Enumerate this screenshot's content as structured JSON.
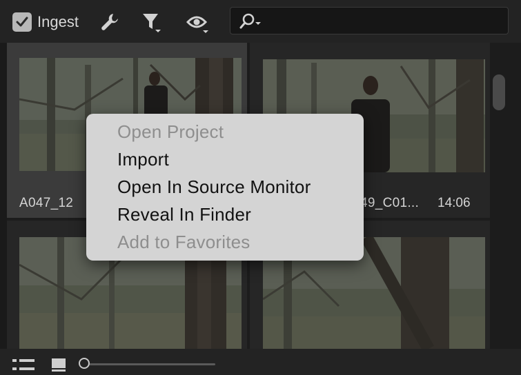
{
  "toolbar": {
    "ingest_label": "Ingest",
    "ingest_checked": true,
    "icons": [
      "wrench-icon",
      "filter-icon",
      "eye-icon"
    ],
    "search": {
      "value": "",
      "placeholder": ""
    }
  },
  "clips": [
    {
      "name": "A047_12",
      "duration": "",
      "selected": true
    },
    {
      "name": "49_C01...",
      "duration": "14:06",
      "selected": false
    },
    {
      "name": "",
      "duration": "",
      "selected": false
    },
    {
      "name": "",
      "duration": "",
      "selected": false
    }
  ],
  "context_menu": {
    "items": [
      {
        "label": "Open Project",
        "enabled": false
      },
      {
        "label": "Import",
        "enabled": true
      },
      {
        "label": "Open In Source Monitor",
        "enabled": true
      },
      {
        "label": "Reveal In Finder",
        "enabled": true
      },
      {
        "label": "Add to Favorites",
        "enabled": false
      }
    ]
  },
  "bottom_bar": {
    "icons": [
      "list-view-icon",
      "icon-view-icon"
    ],
    "zoom_level": 0
  },
  "colors": {
    "panel_bg": "#1f1f1f",
    "selected_tile": "#3b3b3b",
    "menu_bg": "#d4d4d4",
    "menu_text": "#111111",
    "menu_disabled_text": "#8e8e8e"
  }
}
